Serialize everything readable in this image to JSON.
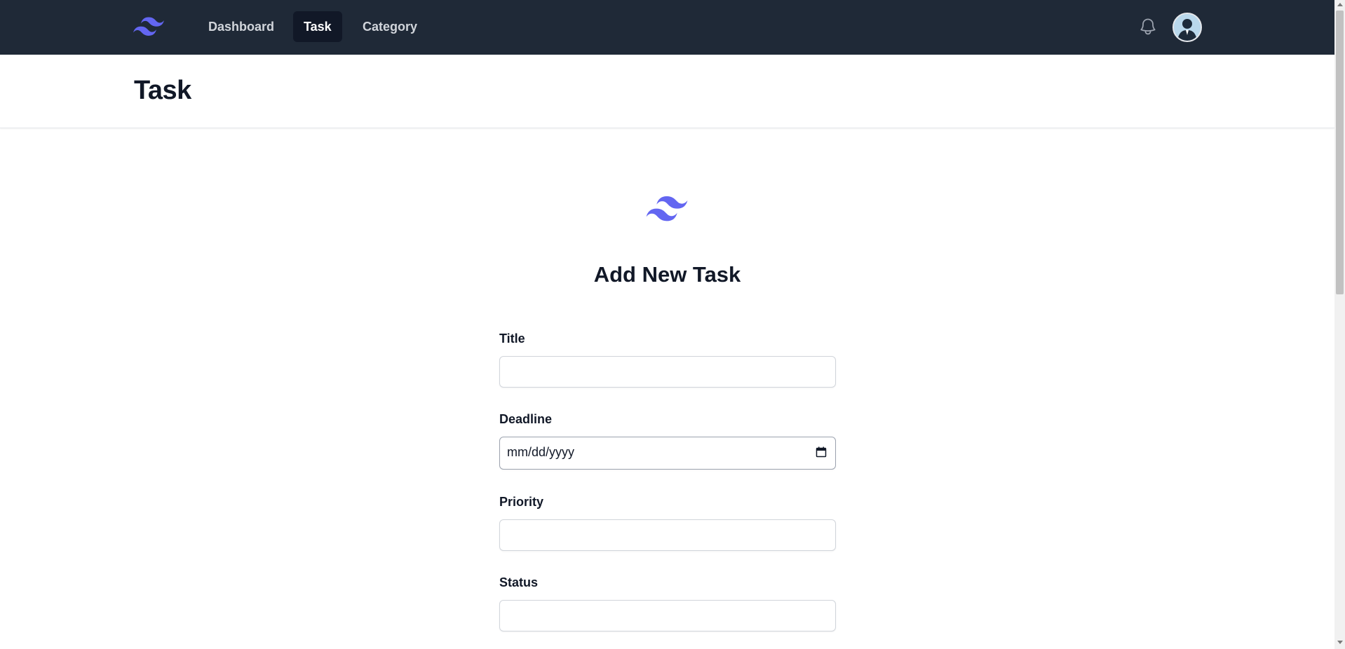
{
  "nav": {
    "logo_icon": "tailwind-logo-icon",
    "links": [
      {
        "label": "Dashboard",
        "active": false
      },
      {
        "label": "Task",
        "active": true
      },
      {
        "label": "Category",
        "active": false
      }
    ],
    "notification_icon": "bell-icon",
    "avatar_icon": "user-avatar"
  },
  "header": {
    "title": "Task"
  },
  "form": {
    "logo_icon": "tailwind-logo-icon",
    "title": "Add New Task",
    "fields": {
      "title": {
        "label": "Title",
        "value": ""
      },
      "deadline": {
        "label": "Deadline",
        "placeholder": "mm/dd/yyyy"
      },
      "priority": {
        "label": "Priority",
        "value": ""
      },
      "status": {
        "label": "Status",
        "value": ""
      }
    }
  },
  "colors": {
    "navbar_bg": "#1f2937",
    "active_tab_bg": "#111827",
    "brand_indigo": "#6366f1"
  }
}
